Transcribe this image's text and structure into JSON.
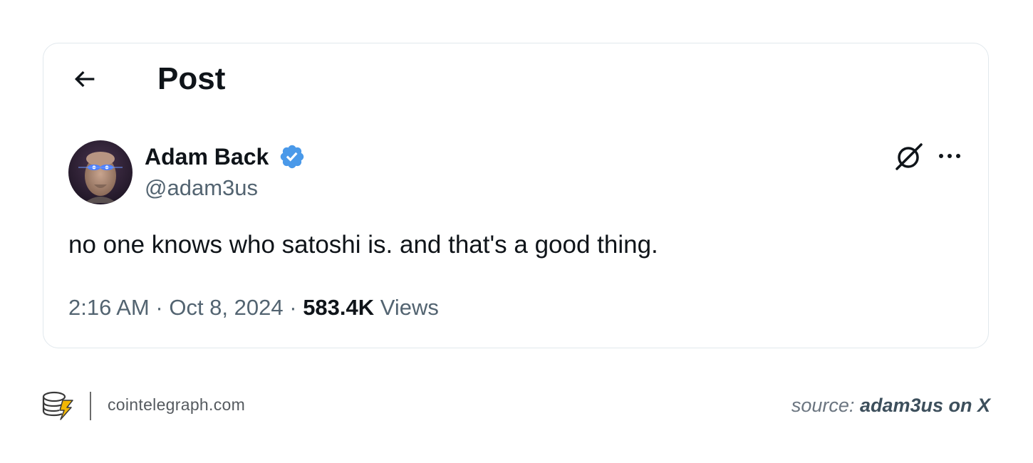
{
  "header": {
    "back_icon": "arrow-left-icon",
    "title": "Post"
  },
  "author": {
    "name": "Adam Back",
    "handle": "@adam3us",
    "verified_icon": "verified-badge-icon",
    "verified_color": "#4a99e9"
  },
  "actions": {
    "grok_icon": "grok-icon",
    "more_icon": "more-horizontal-icon"
  },
  "tweet": {
    "text": "no one knows who satoshi is. and that's a good thing.",
    "time": "2:16 AM",
    "separator": "·",
    "date": "Oct 8, 2024",
    "views_count": "583.4K",
    "views_label": "Views"
  },
  "footer": {
    "logo_icon": "cointelegraph-logo-icon",
    "site": "cointelegraph.com",
    "source_prefix": "source:",
    "source_name": "adam3us on X"
  },
  "colors": {
    "text_primary": "#0f1419",
    "text_secondary": "#536471",
    "card_border": "#e1e8ed",
    "accent_verified": "#4a99e9",
    "logo_yellow": "#f2b705"
  }
}
